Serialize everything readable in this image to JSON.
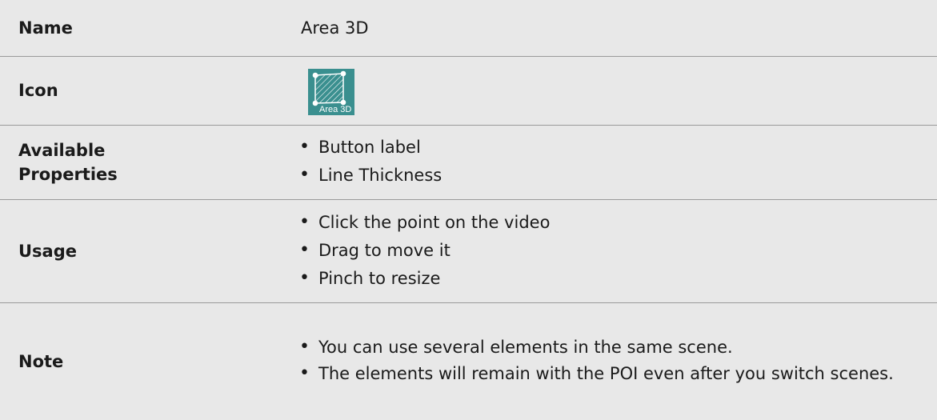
{
  "table": {
    "name": {
      "label": "Name",
      "value": "Area 3D"
    },
    "icon": {
      "label": "Icon",
      "icon_name": "area-3d-icon",
      "icon_caption": "Area 3D",
      "icon_color": "#3a8f8f"
    },
    "available_properties": {
      "label_line1": "Available",
      "label_line2": "Properties",
      "items": [
        "Button label",
        "Line Thickness"
      ]
    },
    "usage": {
      "label": "Usage",
      "items": [
        "Click the point on the video",
        "Drag to move it",
        "Pinch to resize"
      ]
    },
    "note": {
      "label": "Note",
      "items": [
        "You can use several elements in the same scene.",
        "The elements will remain with the POI even after you switch scenes."
      ]
    }
  }
}
